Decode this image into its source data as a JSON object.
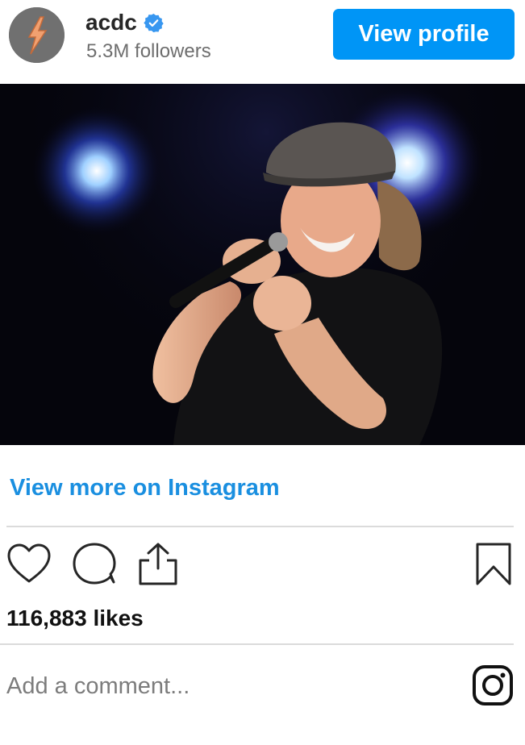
{
  "header": {
    "avatar_icon": "lightning-bolt-logo",
    "username": "acdc",
    "verified_icon": "verified-badge-icon",
    "followers": "5.3M followers",
    "view_profile_label": "View profile"
  },
  "post": {
    "image_alt": "Singer in flat cap singing into a microphone on stage under blue lights"
  },
  "link": {
    "view_more_label": "View more on Instagram"
  },
  "actions": {
    "icons": [
      "heart-icon",
      "comment-icon",
      "share-icon",
      "bookmark-icon"
    ]
  },
  "likes": {
    "text": "116,883 likes"
  },
  "comment": {
    "placeholder": "Add a comment...",
    "value": "",
    "logo_icon": "instagram-icon"
  },
  "colors": {
    "accent": "#0095f6",
    "link": "#1a8fe0",
    "divider": "#dbdbdb",
    "muted_text": "#6e6e6e"
  }
}
